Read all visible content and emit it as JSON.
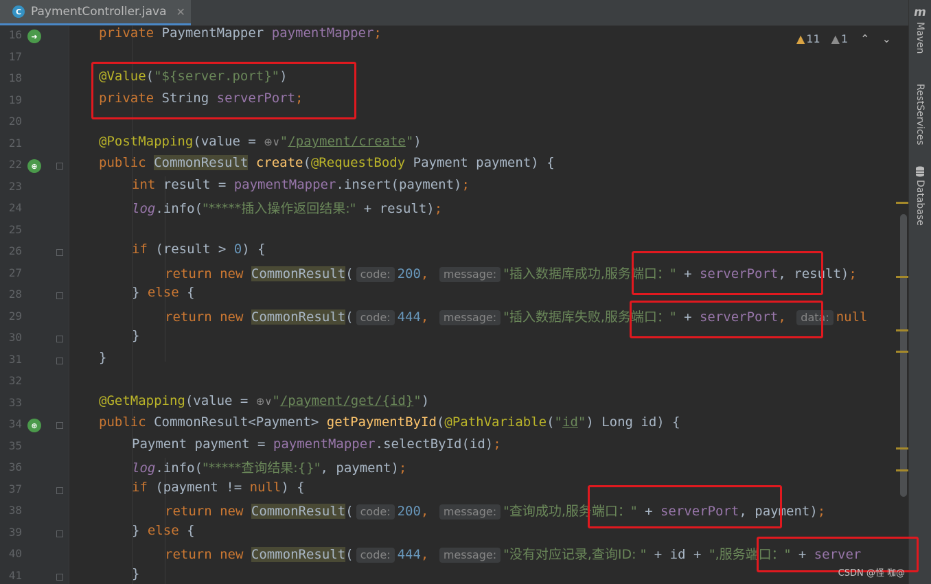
{
  "tab": {
    "icon": "C",
    "title": "PaymentController.java",
    "close": "✕"
  },
  "inspections": {
    "warnings": "11",
    "weak_warnings": "1"
  },
  "right_tools": {
    "maven_logo": "m",
    "maven": "Maven",
    "rest": "RestServices",
    "database": "Database"
  },
  "line_numbers": [
    "16",
    "17",
    "18",
    "19",
    "20",
    "21",
    "22",
    "23",
    "24",
    "25",
    "26",
    "27",
    "28",
    "29",
    "30",
    "31",
    "32",
    "33",
    "34",
    "35",
    "36",
    "37",
    "38",
    "39",
    "40",
    "41"
  ],
  "code": {
    "l16": {
      "kw": "private",
      "type": "PaymentMapper",
      "field": "paymentMapper",
      "semi": ";"
    },
    "l18": {
      "ann": "@Value",
      "open": "(",
      "str": "\"${server.port}\"",
      "close": ")"
    },
    "l19": {
      "kw": "private",
      "type": "String",
      "field": "serverPort",
      "semi": ";"
    },
    "l21": {
      "ann": "@PostMapping",
      "pre": "(value = ",
      "icons": "⊕∨",
      "q1": "\"",
      "url": "/payment/create",
      "q2": "\"",
      "close": ")"
    },
    "l22": {
      "kw": "public",
      "type": "CommonResult",
      "method": "create",
      "ann": "@RequestBody",
      "rest": " Payment payment) {",
      "open": "("
    },
    "l23": {
      "kw": "int",
      "a": " result = ",
      "field": "paymentMapper",
      "b": ".insert(payment)",
      "semi": ";"
    },
    "l24": {
      "log": "log",
      "a": ".info(",
      "str": "\"*****插入操作返回结果:\"",
      "b": " + result)",
      "semi": ";"
    },
    "l26": {
      "kw": "if",
      "a": " (result > ",
      "num": "0",
      "b": ") {"
    },
    "l27": {
      "kw1": "return",
      "kw2": "new",
      "type": "CommonResult",
      "open": "(",
      "h1": "code:",
      "num": "200",
      "comma": ",",
      "h2": "message:",
      "str": "\"插入数据库成功,服务端口：\"",
      "plus": " + ",
      "field": "serverPort",
      "rest": ", result)",
      "semi": ";"
    },
    "l28": {
      "a": "} ",
      "kw": "else",
      "b": " {"
    },
    "l29": {
      "kw1": "return",
      "kw2": "new",
      "type": "CommonResult",
      "open": "(",
      "h1": "code:",
      "num": "444",
      "comma": ",",
      "h2": "message:",
      "str": "\"插入数据库失败,服务端口：\"",
      "plus": " + ",
      "field": "serverPort",
      "comma2": ",",
      "h3": "data:",
      "nul": "null"
    },
    "l30": {
      "a": "}"
    },
    "l31": {
      "a": "}"
    },
    "l33": {
      "ann": "@GetMapping",
      "pre": "(value = ",
      "icons": "⊕∨",
      "q1": "\"",
      "url": "/payment/get/{id}",
      "q2": "\"",
      "close": ")"
    },
    "l34": {
      "kw": "public",
      "type": "CommonResult<Payment>",
      "method": "getPaymentById",
      "ann": "@PathVariable",
      "p1": "(",
      "q1": "\"",
      "arg": "id",
      "q2": "\"",
      "rest": ") Long id) {",
      "open": "("
    },
    "l35": {
      "a": "Payment payment = ",
      "field": "paymentMapper",
      "b": ".selectById(id)",
      "semi": ";"
    },
    "l36": {
      "log": "log",
      "a": ".info(",
      "str": "\"*****查询结果:{}\"",
      "b": ", payment)",
      "semi": ";"
    },
    "l37": {
      "kw": "if",
      "a": " (payment != ",
      "nul": "null",
      "b": ") {"
    },
    "l38": {
      "kw1": "return",
      "kw2": "new",
      "type": "CommonResult",
      "open": "(",
      "h1": "code:",
      "num": "200",
      "comma": ",",
      "h2": "message:",
      "str": "\"查询成功,服务端口：\"",
      "plus": " + ",
      "field": "serverPort",
      "rest": ", payment)",
      "semi": ";"
    },
    "l39": {
      "a": "} ",
      "kw": "else",
      "b": " {"
    },
    "l40": {
      "kw1": "return",
      "kw2": "new",
      "type": "CommonResult",
      "open": "(",
      "h1": "code:",
      "num": "444",
      "comma": ",",
      "h2": "message:",
      "str1": "\"没有对应记录,查询ID: \"",
      "plus1": " + id + ",
      "str2": "\",服务端口：\"",
      "plus2": " + ",
      "field": "server"
    },
    "l41": {
      "a": "}"
    }
  },
  "watermark": "CSDN @怪 咖@",
  "colors": {
    "highlight_box": "#e0191f",
    "keyword": "#cc7832",
    "annotation": "#bbb529",
    "string": "#6a8759",
    "field": "#9876aa"
  }
}
